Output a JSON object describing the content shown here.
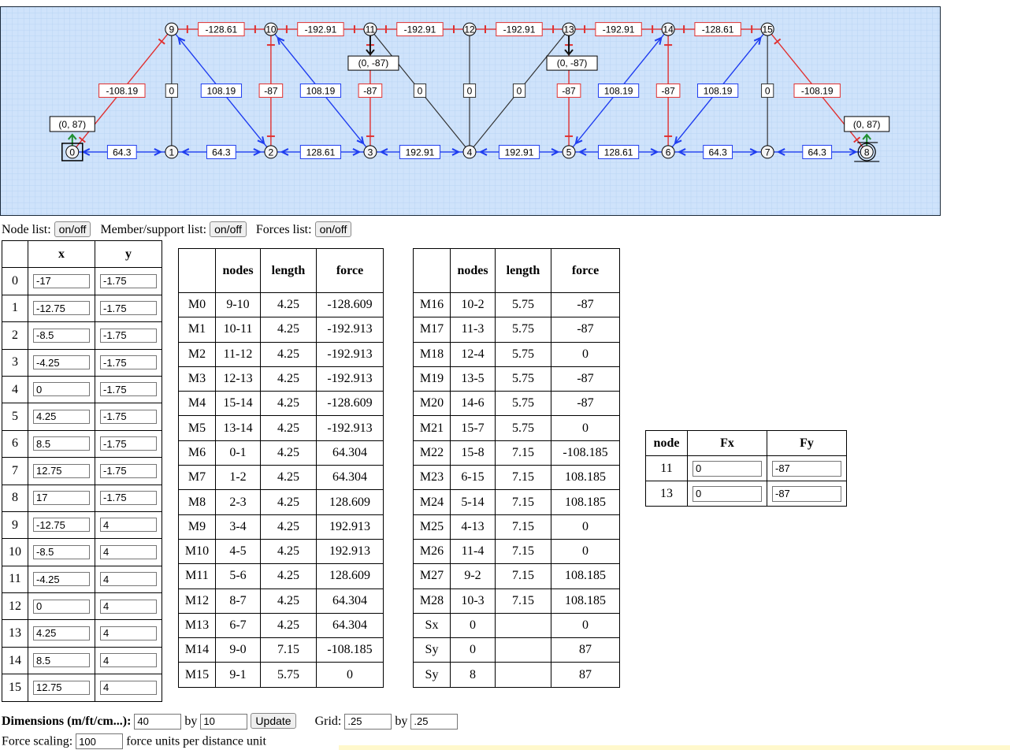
{
  "toolbar": {
    "node_list_label": "Node list:",
    "member_list_label": "Member/support list:",
    "forces_list_label": "Forces list:",
    "toggle_label": "on/off"
  },
  "nodes_table": {
    "headers": [
      "",
      "x",
      "y"
    ],
    "rows": [
      {
        "id": "0",
        "x": "-17",
        "y": "-1.75"
      },
      {
        "id": "1",
        "x": "-12.75",
        "y": "-1.75"
      },
      {
        "id": "2",
        "x": "-8.5",
        "y": "-1.75"
      },
      {
        "id": "3",
        "x": "-4.25",
        "y": "-1.75"
      },
      {
        "id": "4",
        "x": "0",
        "y": "-1.75"
      },
      {
        "id": "5",
        "x": "4.25",
        "y": "-1.75"
      },
      {
        "id": "6",
        "x": "8.5",
        "y": "-1.75"
      },
      {
        "id": "7",
        "x": "12.75",
        "y": "-1.75"
      },
      {
        "id": "8",
        "x": "17",
        "y": "-1.75"
      },
      {
        "id": "9",
        "x": "-12.75",
        "y": "4"
      },
      {
        "id": "10",
        "x": "-8.5",
        "y": "4"
      },
      {
        "id": "11",
        "x": "-4.25",
        "y": "4"
      },
      {
        "id": "12",
        "x": "0",
        "y": "4"
      },
      {
        "id": "13",
        "x": "4.25",
        "y": "4"
      },
      {
        "id": "14",
        "x": "8.5",
        "y": "4"
      },
      {
        "id": "15",
        "x": "12.75",
        "y": "4"
      }
    ]
  },
  "members_table": {
    "headers": [
      "",
      "nodes",
      "length",
      "force"
    ],
    "rows_left": [
      [
        "M0",
        "9-10",
        "4.25",
        "-128.609"
      ],
      [
        "M1",
        "10-11",
        "4.25",
        "-192.913"
      ],
      [
        "M2",
        "11-12",
        "4.25",
        "-192.913"
      ],
      [
        "M3",
        "12-13",
        "4.25",
        "-192.913"
      ],
      [
        "M4",
        "15-14",
        "4.25",
        "-128.609"
      ],
      [
        "M5",
        "13-14",
        "4.25",
        "-192.913"
      ],
      [
        "M6",
        "0-1",
        "4.25",
        "64.304"
      ],
      [
        "M7",
        "1-2",
        "4.25",
        "64.304"
      ],
      [
        "M8",
        "2-3",
        "4.25",
        "128.609"
      ],
      [
        "M9",
        "3-4",
        "4.25",
        "192.913"
      ],
      [
        "M10",
        "4-5",
        "4.25",
        "192.913"
      ],
      [
        "M11",
        "5-6",
        "4.25",
        "128.609"
      ],
      [
        "M12",
        "8-7",
        "4.25",
        "64.304"
      ],
      [
        "M13",
        "6-7",
        "4.25",
        "64.304"
      ],
      [
        "M14",
        "9-0",
        "7.15",
        "-108.185"
      ],
      [
        "M15",
        "9-1",
        "5.75",
        "0"
      ]
    ],
    "rows_right": [
      [
        "M16",
        "10-2",
        "5.75",
        "-87"
      ],
      [
        "M17",
        "11-3",
        "5.75",
        "-87"
      ],
      [
        "M18",
        "12-4",
        "5.75",
        "0"
      ],
      [
        "M19",
        "13-5",
        "5.75",
        "-87"
      ],
      [
        "M20",
        "14-6",
        "5.75",
        "-87"
      ],
      [
        "M21",
        "15-7",
        "5.75",
        "0"
      ],
      [
        "M22",
        "15-8",
        "7.15",
        "-108.185"
      ],
      [
        "M23",
        "6-15",
        "7.15",
        "108.185"
      ],
      [
        "M24",
        "5-14",
        "7.15",
        "108.185"
      ],
      [
        "M25",
        "4-13",
        "7.15",
        "0"
      ],
      [
        "M26",
        "11-4",
        "7.15",
        "0"
      ],
      [
        "M27",
        "9-2",
        "7.15",
        "108.185"
      ],
      [
        "M28",
        "10-3",
        "7.15",
        "108.185"
      ],
      [
        "Sx",
        "0",
        "",
        "0"
      ],
      [
        "Sy",
        "0",
        "",
        "87"
      ],
      [
        "Sy",
        "8",
        "",
        "87"
      ]
    ]
  },
  "forces_table": {
    "headers": [
      "node",
      "Fx",
      "Fy"
    ],
    "rows": [
      {
        "node": "11",
        "fx": "0",
        "fy": "-87"
      },
      {
        "node": "13",
        "fx": "0",
        "fy": "-87"
      }
    ]
  },
  "dimensions": {
    "label": "Dimensions (m/ft/cm...):",
    "width": "40",
    "by": "by",
    "height": "10",
    "update_label": "Update",
    "grid_label": "Grid:",
    "grid_x": ".25",
    "grid_y": ".25"
  },
  "scaling": {
    "label": "Force scaling:",
    "value": "100",
    "units": "force units per distance unit"
  },
  "diagram": {
    "member_labels": {
      "M0": "-128.61",
      "M1": "-192.91",
      "M2": "-192.91",
      "M3": "-192.91",
      "M4": "-128.61",
      "M5": "-192.91",
      "M6": "64.3",
      "M7": "64.3",
      "M8": "128.61",
      "M9": "192.91",
      "M10": "192.91",
      "M11": "128.61",
      "M12": "64.3",
      "M13": "64.3",
      "M14": "-108.19",
      "M15": "0",
      "M16": "-87",
      "M17": "-87",
      "M18": "0",
      "M19": "-87",
      "M20": "-87",
      "M21": "0",
      "M22": "-108.19",
      "M23": "108.19",
      "M24": "108.19",
      "M25": "0",
      "M26": "0",
      "M27": "108.19",
      "M28": "108.19"
    },
    "load_labels": {
      "11": "(0, -87)",
      "13": "(0, -87)"
    },
    "reaction_labels": {
      "0": "(0, 87)",
      "8": "(0, 87)"
    },
    "colors": {
      "background": "#cfe3fb",
      "grid": "#b9d4f3",
      "tension": "#1f3df0",
      "compression": "#e03030",
      "zero": "#333333",
      "support": "#1f8f2f",
      "load": "#111111"
    }
  }
}
